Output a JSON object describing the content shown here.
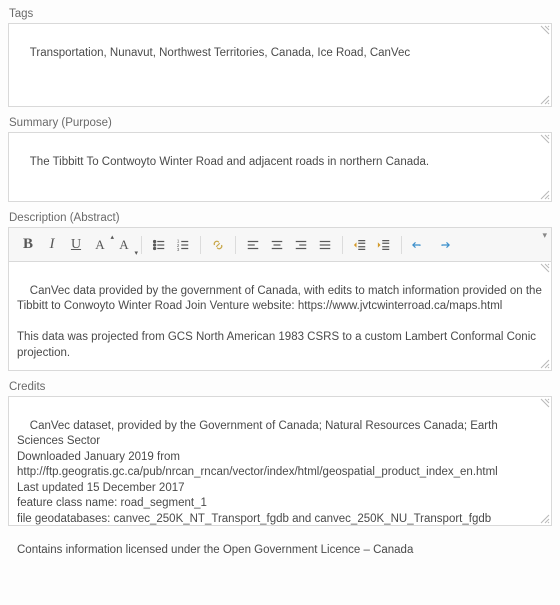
{
  "tags": {
    "label": "Tags",
    "value": "Transportation, Nunavut, Northwest Territories, Canada, Ice Road, CanVec"
  },
  "summary": {
    "label": "Summary (Purpose)",
    "value": "The Tibbitt To Contwoyto Winter Road and adjacent roads in northern Canada."
  },
  "description": {
    "label": "Description (Abstract)",
    "value": "CanVec data provided by the government of Canada, with edits to match information provided on the Tibbitt to Conwoyto Winter Road Join Venture website: https://www.jvtcwinterroad.ca/maps.html\n\nThis data was projected from GCS North American 1983 CSRS to a custom Lambert Conformal Conic projection."
  },
  "credits": {
    "label": "Credits",
    "value": "CanVec dataset, provided by the Government of Canada; Natural Resources Canada; Earth Sciences Sector\nDownloaded January 2019 from http://ftp.geogratis.gc.ca/pub/nrcan_rncan/vector/index/html/geospatial_product_index_en.html\nLast updated 15 December 2017\nfeature class name: road_segment_1\nfile geodatabases: canvec_250K_NT_Transport_fgdb and canvec_250K_NU_Transport_fgdb\n\nContains information licensed under the Open Government Licence – Canada"
  },
  "toolbar": {
    "style_dropdown": "▾"
  }
}
